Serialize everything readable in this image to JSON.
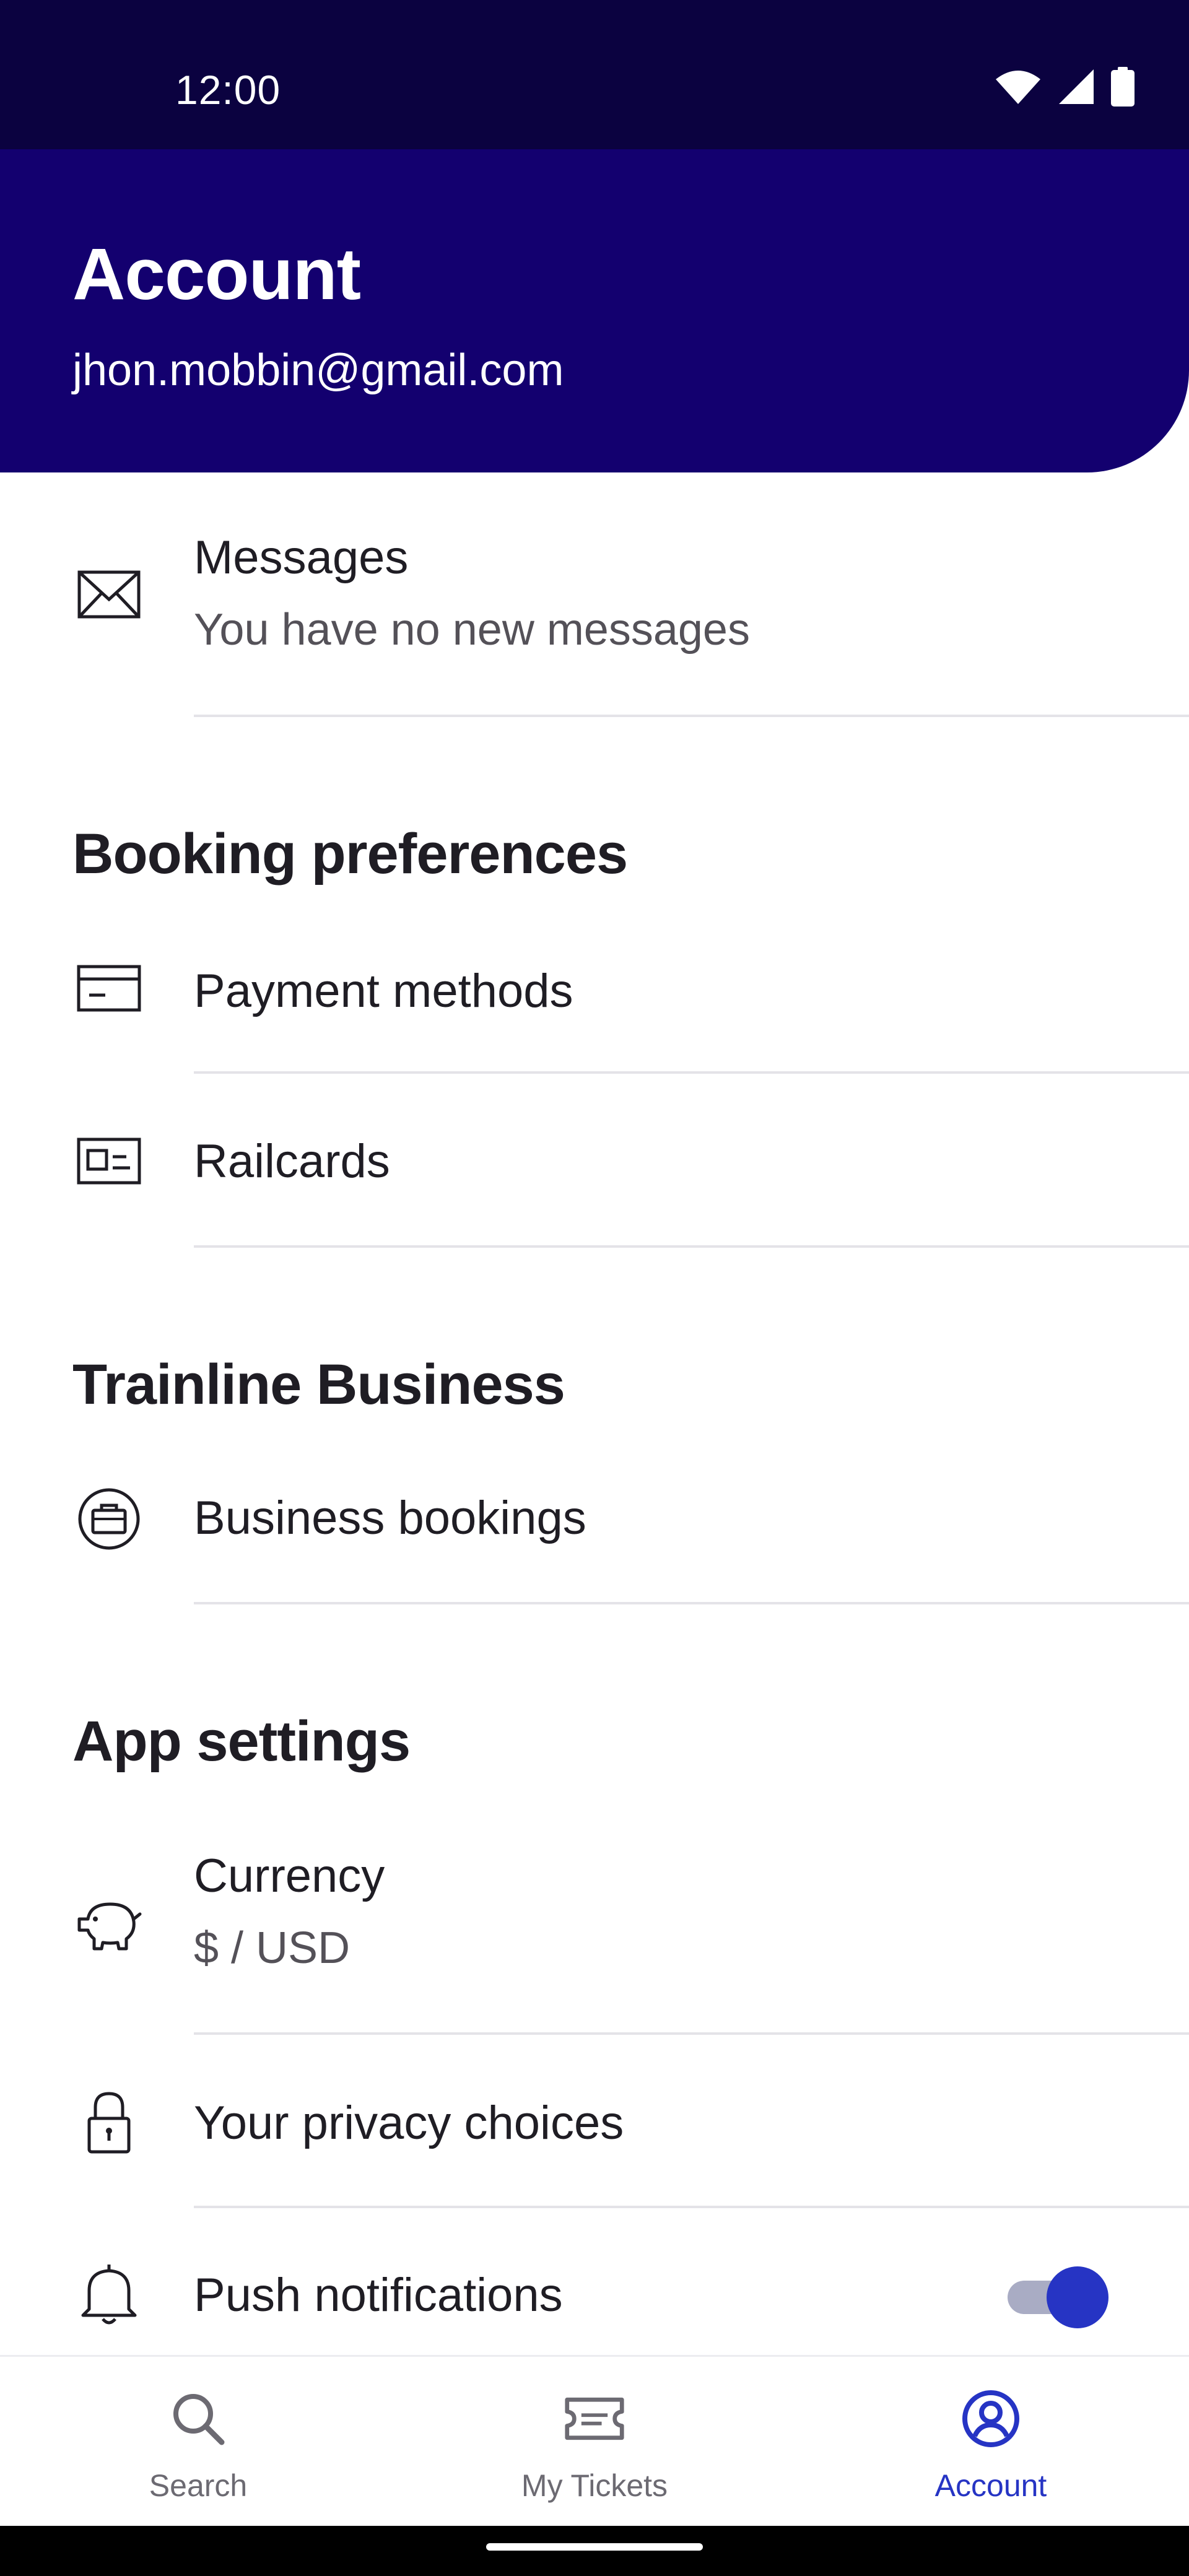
{
  "status_bar": {
    "time": "12:00",
    "icons": [
      "wifi-icon",
      "cellular-signal-icon",
      "battery-icon"
    ]
  },
  "header": {
    "title": "Account",
    "email": "jhon.mobbin@gmail.com"
  },
  "messages": {
    "title": "Messages",
    "subtitle": "You have no new messages",
    "icon": "envelope-icon"
  },
  "sections": {
    "booking_preferences": {
      "title": "Booking preferences",
      "items": [
        {
          "label": "Payment methods",
          "icon": "credit-card-icon"
        },
        {
          "label": "Railcards",
          "icon": "railcard-icon"
        }
      ]
    },
    "trainline_business": {
      "title": "Trainline Business",
      "items": [
        {
          "label": "Business bookings",
          "icon": "briefcase-icon"
        }
      ]
    },
    "app_settings": {
      "title": "App settings",
      "currency": {
        "label": "Currency",
        "value": "$ / USD",
        "icon": "piggy-bank-icon"
      },
      "privacy": {
        "label": "Your privacy choices",
        "icon": "lock-icon"
      },
      "push": {
        "label": "Push notifications",
        "icon": "bell-icon",
        "enabled": true
      }
    }
  },
  "bottom_nav": {
    "items": [
      {
        "label": "Search",
        "icon": "search-icon",
        "active": false
      },
      {
        "label": "My Tickets",
        "icon": "ticket-icon",
        "active": false
      },
      {
        "label": "Account",
        "icon": "account-icon",
        "active": true
      }
    ]
  },
  "colors": {
    "status_bar": "#0b0240",
    "header": "#13006f",
    "accent": "#2634c4",
    "toggle_track": "#a9acc4",
    "text": "#1f1d24",
    "muted_text": "#545158",
    "divider": "#e4e3e8"
  }
}
